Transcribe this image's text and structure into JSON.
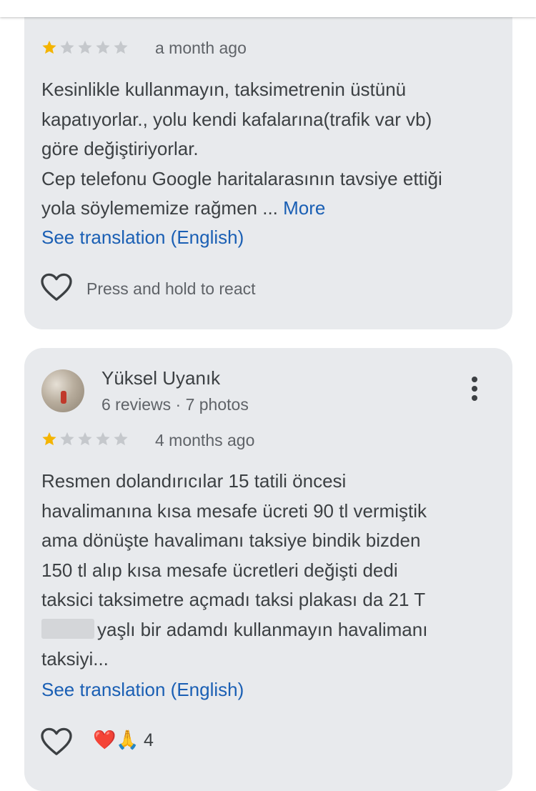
{
  "colors": {
    "star_filled": "#f4b400",
    "star_empty": "#c5c8cc",
    "link": "#1a5fb4",
    "card_bg": "#e8eaed"
  },
  "review1": {
    "rating": 1,
    "max_rating": 5,
    "date": "a month ago",
    "body_lines": [
      "Kesinlikle kullanmayın, taksimetrenin üstünü",
      "kapatıyorlar., yolu kendi kafalarına(trafik var vb)",
      "göre değiştiriyorlar.",
      "Cep telefonu Google haritalarasının tavsiye ettiği",
      "yola söylememize rağmen ..."
    ],
    "more_label": "More",
    "translate_label": "See translation (English)",
    "react_hint": "Press and hold to react"
  },
  "review2": {
    "author": "Yüksel Uyanık",
    "meta": "6 reviews · 7 photos",
    "rating": 1,
    "max_rating": 5,
    "date": "4 months ago",
    "body_lines": [
      "Resmen dolandırıcılar 15 tatili öncesi",
      "havalimanına kısa mesafe ücreti 90 tl vermiştik",
      "ama dönüşte havalimanı taksiye bindik bizden",
      "150 tl alıp kısa mesafe ücretleri değişti dedi",
      "taksici taksimetre açmadı taksi plakası da 21 T",
      "yaşlı bir adamdı kullanmayın havalimanı",
      "taksiyi..."
    ],
    "translate_label": "See translation (English)",
    "reaction_emojis": "❤️🙏",
    "reaction_count": "4"
  }
}
